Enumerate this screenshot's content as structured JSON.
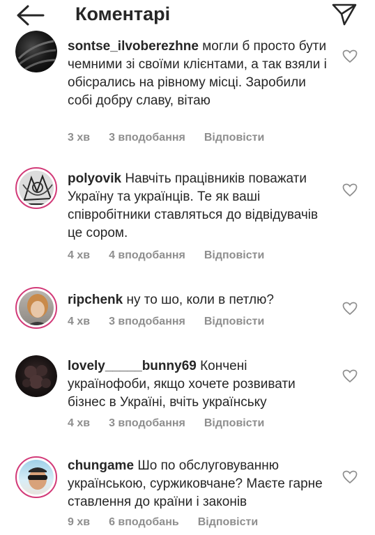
{
  "header": {
    "title": "Коментарі",
    "back_icon": "arrow-left-icon",
    "send_icon": "paper-plane-icon"
  },
  "comments": [
    {
      "username": "sontse_ilvoberezhne",
      "text": "могли б просто бути чемними зі своїми клієнтами, а так взяли і обісрались на рівному місці. Заробили собі добру славу, вітаю",
      "time": "3 хв",
      "likes": "3 вподобання",
      "reply": "Відповісти"
    },
    {
      "username": "polyovik",
      "text": "Навчіть працівників поважати Україну та українців. Те як ваші співробітники ставляться до відвідувачів це сором.",
      "time": "4 хв",
      "likes": "4 вподобання",
      "reply": "Відповісти"
    },
    {
      "username": "ripchenk",
      "text": "ну то шо, коли в петлю?",
      "time": "4 хв",
      "likes": "3 вподобання",
      "reply": "Відповісти"
    },
    {
      "username": "lovely_____bunny69",
      "text": "Кончені українофоби, якщо хочете розвивати бізнес в Україні, вчіть українську",
      "time": "4 хв",
      "likes": "3 вподобання",
      "reply": "Відповісти"
    },
    {
      "username": "chungame",
      "text": "Шо по обслуговуванню українською, суржиковчане? Маєте гарне ставлення до країни і законів",
      "time": "9 хв",
      "likes": "6 вподобань",
      "reply": "Відповісти"
    }
  ],
  "colors": {
    "text": "#262626",
    "secondary": "#8e8e8e",
    "story_ring": "#d23a78"
  }
}
